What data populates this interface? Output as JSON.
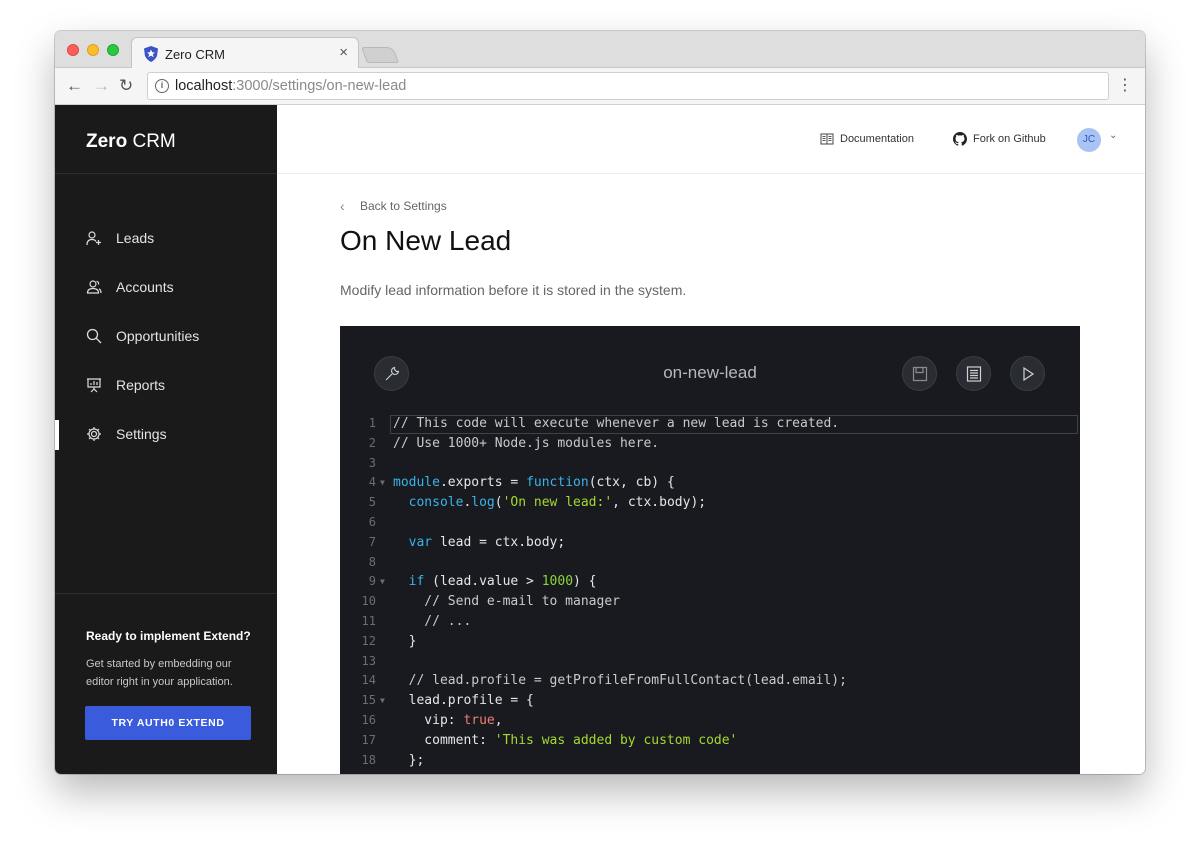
{
  "browser": {
    "tab_title": "Zero CRM",
    "tab_close": "×",
    "url_host": "localhost",
    "url_path": ":3000/settings/on-new-lead"
  },
  "sidebar": {
    "logo_bold": "Zero",
    "logo_light": "CRM",
    "items": [
      {
        "label": "Leads",
        "icon": "user-plus-icon"
      },
      {
        "label": "Accounts",
        "icon": "users-icon"
      },
      {
        "label": "Opportunities",
        "icon": "search-icon"
      },
      {
        "label": "Reports",
        "icon": "presentation-icon"
      },
      {
        "label": "Settings",
        "icon": "gear-icon",
        "active": true
      }
    ],
    "promo": {
      "title": "Ready to implement Extend?",
      "text": "Get started by embedding our editor right in your application.",
      "button": "TRY AUTH0 EXTEND"
    }
  },
  "header": {
    "documentation": "Documentation",
    "fork": "Fork on Github",
    "avatar": "JC"
  },
  "page": {
    "back": "Back to Settings",
    "title": "On New Lead",
    "description": "Modify lead information before it is stored in the system."
  },
  "editor": {
    "title": "on-new-lead",
    "accent_keyword": "#39b4e8",
    "accent_string": "#a6d82e",
    "lines": [
      {
        "n": "1",
        "fold": false,
        "parts": [
          [
            "com",
            "// This code will execute whenever a new lead is created."
          ]
        ]
      },
      {
        "n": "2",
        "fold": false,
        "parts": [
          [
            "com",
            "// Use 1000+ Node.js modules here."
          ]
        ]
      },
      {
        "n": "3",
        "fold": false,
        "parts": []
      },
      {
        "n": "4",
        "fold": true,
        "parts": [
          [
            "kw",
            "module"
          ],
          [
            "",
            ".exports = "
          ],
          [
            "kw",
            "function"
          ],
          [
            "",
            "(ctx, cb) {"
          ]
        ]
      },
      {
        "n": "5",
        "fold": false,
        "parts": [
          [
            "",
            "  "
          ],
          [
            "kw",
            "console"
          ],
          [
            "",
            "."
          ],
          [
            "kw",
            "log"
          ],
          [
            "",
            "("
          ],
          [
            "str",
            "'On new lead:'"
          ],
          [
            "",
            ", ctx.body);"
          ]
        ]
      },
      {
        "n": "6",
        "fold": false,
        "parts": []
      },
      {
        "n": "7",
        "fold": false,
        "parts": [
          [
            "",
            "  "
          ],
          [
            "kw",
            "var"
          ],
          [
            "",
            " lead = ctx.body;"
          ]
        ]
      },
      {
        "n": "8",
        "fold": false,
        "parts": []
      },
      {
        "n": "9",
        "fold": true,
        "parts": [
          [
            "",
            "  "
          ],
          [
            "kw",
            "if"
          ],
          [
            "",
            " (lead.value > "
          ],
          [
            "num",
            "1000"
          ],
          [
            "",
            ") {"
          ]
        ]
      },
      {
        "n": "10",
        "fold": false,
        "parts": [
          [
            "com",
            "    // Send e-mail to manager"
          ]
        ]
      },
      {
        "n": "11",
        "fold": false,
        "parts": [
          [
            "com",
            "    // ..."
          ]
        ]
      },
      {
        "n": "12",
        "fold": false,
        "parts": [
          [
            "",
            "  }"
          ]
        ]
      },
      {
        "n": "13",
        "fold": false,
        "parts": []
      },
      {
        "n": "14",
        "fold": false,
        "parts": [
          [
            "com",
            "  // lead.profile = getProfileFromFullContact(lead.email);"
          ]
        ]
      },
      {
        "n": "15",
        "fold": true,
        "parts": [
          [
            "",
            "  lead.profile = {"
          ]
        ]
      },
      {
        "n": "16",
        "fold": false,
        "parts": [
          [
            "",
            "    vip: "
          ],
          [
            "bool",
            "true"
          ],
          [
            "",
            ","
          ]
        ]
      },
      {
        "n": "17",
        "fold": false,
        "parts": [
          [
            "",
            "    comment: "
          ],
          [
            "str",
            "'This was added by custom code'"
          ]
        ]
      },
      {
        "n": "18",
        "fold": false,
        "parts": [
          [
            "",
            "  };"
          ]
        ]
      }
    ]
  }
}
